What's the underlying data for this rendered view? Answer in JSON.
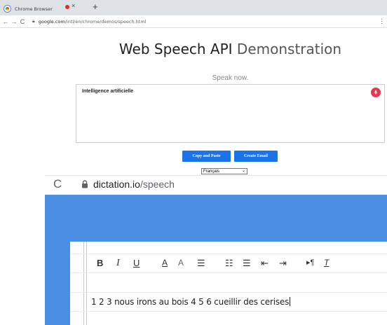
{
  "browser": {
    "tab_title": "Chrome Browser",
    "tab_close": "×",
    "new_tab": "+",
    "back": "←",
    "forward": "→",
    "reload": "C",
    "url_host": "google.com",
    "url_path": "/intl/en/chrome/demos/speech.html",
    "menu": "⋮"
  },
  "demo": {
    "title_strong": "Web Speech API",
    "title_light": "Demonstration",
    "status": "Speak now.",
    "transcript": "Intelligence artificielle",
    "copy_button": "Copy and Paste",
    "email_button": "Create Email",
    "language_selected": "Français"
  },
  "dictation": {
    "reload": "C",
    "url_host": "dictation.io",
    "url_path": "/speech",
    "toolbar": {
      "bold": "B",
      "italic": "I",
      "underline": "U",
      "font_color": "A",
      "highlight": "A",
      "align": "☰",
      "ordered_list": "☷",
      "unordered_list": "☰",
      "outdent": "⇤",
      "indent": "⇥",
      "paragraph": "▸¶",
      "clear_format": "T"
    },
    "text": "1 2 3 nous irons au bois 4 5 6 cueillir des cerises"
  },
  "colors": {
    "accent": "#1a73e8",
    "band": "#4a8fe3",
    "mic": "#e53950"
  }
}
